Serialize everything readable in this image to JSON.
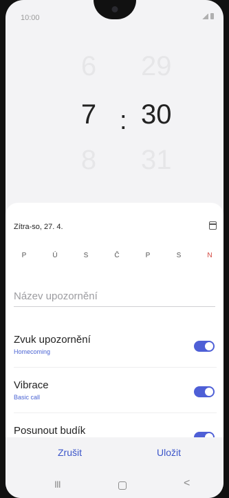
{
  "status_bar": {
    "time": "10:00"
  },
  "picker": {
    "hour_prev": "6",
    "hour": "7",
    "hour_next": "8",
    "separator": ":",
    "minute_prev": "29",
    "minute": "30",
    "minute_next": "31"
  },
  "sheet": {
    "date": "Zítra-so, 27. 4.",
    "days": [
      "P",
      "Ú",
      "S",
      "Č",
      "P",
      "S",
      "N"
    ],
    "name_placeholder": "Název upozornění",
    "options": [
      {
        "title": "Zvuk upozornění",
        "subtitle": "Homecoming",
        "enabled": true
      },
      {
        "title": "Vibrace",
        "subtitle": "Basic call",
        "enabled": true
      },
      {
        "title": "Posunout budík",
        "subtitle": "",
        "enabled": true
      }
    ]
  },
  "actions": {
    "cancel": "Zrušit",
    "save": "Uložit"
  },
  "nav": {
    "recent": "III",
    "back": "<"
  },
  "colors": {
    "accent": "#4e5fd6",
    "sunday": "#d2423a",
    "link": "#3b55c9"
  }
}
